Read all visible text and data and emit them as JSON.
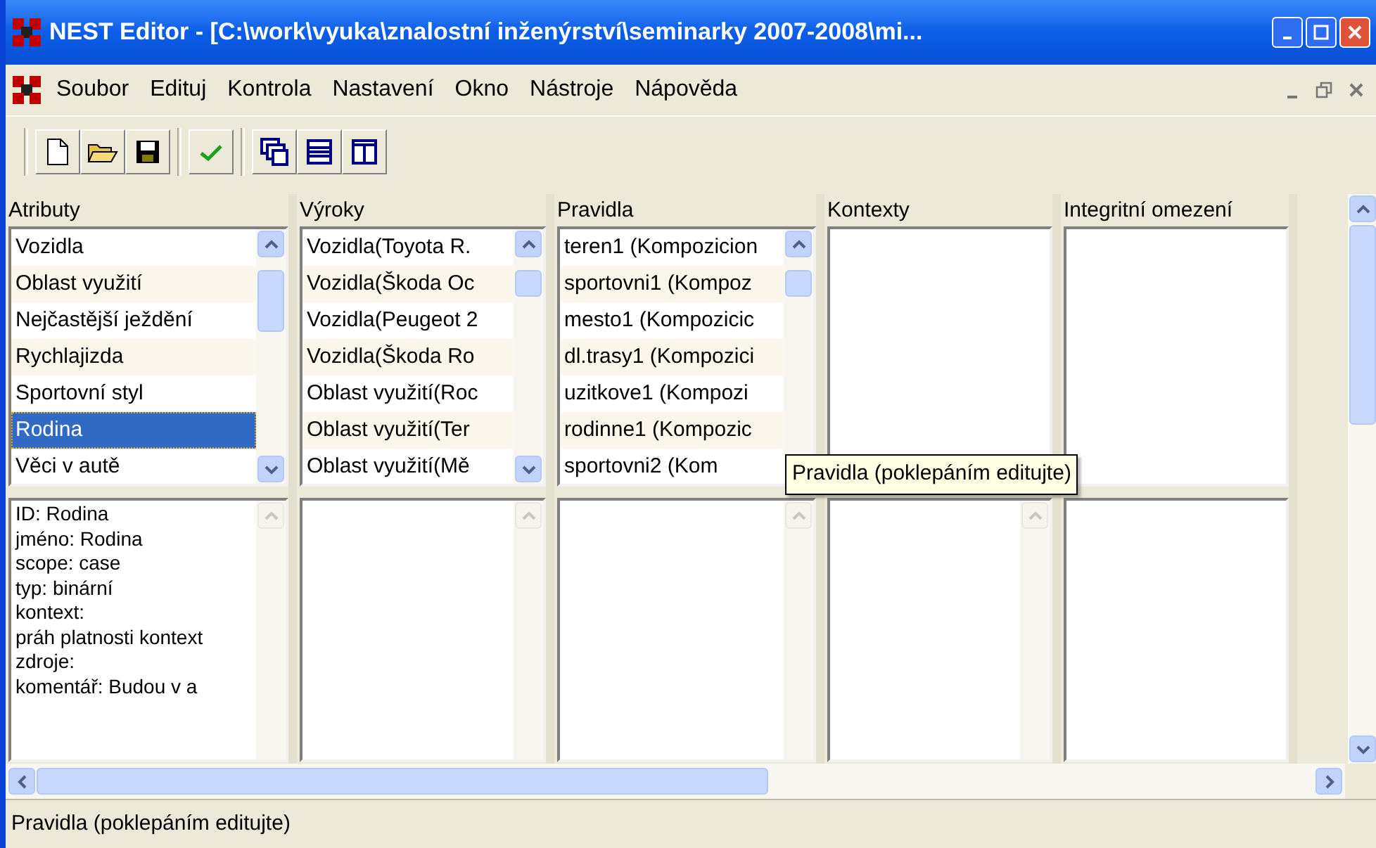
{
  "window": {
    "title": "NEST Editor - [C:\\work\\vyuka\\znalostní inženýrství\\seminarky 2007-2008\\mi..."
  },
  "menu": [
    "Soubor",
    "Edituj",
    "Kontrola",
    "Nastavení",
    "Okno",
    "Nástroje",
    "Nápověda"
  ],
  "columns": [
    {
      "header": "Atributy",
      "items": [
        {
          "label": "Vozidla",
          "selected": false
        },
        {
          "label": "Oblast využití",
          "selected": false
        },
        {
          "label": "Nejčastější ježdění",
          "selected": false
        },
        {
          "label": "Rychlajizda",
          "selected": false
        },
        {
          "label": "Sportovní styl",
          "selected": false
        },
        {
          "label": "Rodina",
          "selected": true
        },
        {
          "label": "Věci v autě",
          "selected": false
        }
      ],
      "details": [
        "ID: Rodina",
        "jméno: Rodina",
        "scope: case",
        "typ: binární",
        "kontext:",
        "práh platnosti kontext",
        "zdroje:",
        "komentář: Budou v a"
      ]
    },
    {
      "header": "Výroky",
      "items": [
        {
          "label": "Vozidla(Toyota R.",
          "selected": false
        },
        {
          "label": "Vozidla(Škoda Oc",
          "selected": false
        },
        {
          "label": "Vozidla(Peugeot 2",
          "selected": false
        },
        {
          "label": "Vozidla(Škoda Ro",
          "selected": false
        },
        {
          "label": "Oblast využití(Roc",
          "selected": false
        },
        {
          "label": "Oblast využití(Ter",
          "selected": false
        },
        {
          "label": "Oblast využití(Mě",
          "selected": false
        }
      ]
    },
    {
      "header": "Pravidla",
      "items": [
        {
          "label": "teren1 (Kompozicion",
          "selected": false
        },
        {
          "label": "sportovni1 (Kompoz",
          "selected": false
        },
        {
          "label": "mesto1 (Kompozicic",
          "selected": false
        },
        {
          "label": "dl.trasy1 (Kompozici",
          "selected": false
        },
        {
          "label": "uzitkove1 (Kompozi",
          "selected": false
        },
        {
          "label": "rodinne1 (Kompozic",
          "selected": false
        },
        {
          "label": "sportovni2 (Kom",
          "selected": false
        }
      ]
    },
    {
      "header": "Kontexty"
    },
    {
      "header": "Integritní omezení"
    }
  ],
  "tooltip": "Pravidla (poklepáním editujte)",
  "status_bar": "Pravidla (poklepáním editujte)"
}
